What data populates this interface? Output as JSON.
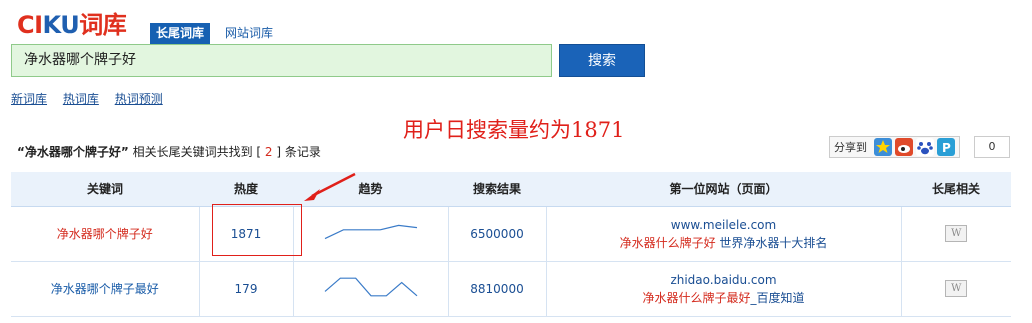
{
  "logo": {
    "part1": "CI",
    "part2": "KU",
    "part3": "词库"
  },
  "tabs": {
    "active": "长尾词库",
    "inactive": "网站词库"
  },
  "search": {
    "value": "净水器哪个牌子好",
    "button": "搜索"
  },
  "links": [
    "新词库",
    "热词库",
    "热词预测"
  ],
  "annotation": "用户日搜索量约为1871",
  "summary": {
    "keyword": "“净水器哪个牌子好”",
    "text1": " 相关长尾关键词共找到 [ ",
    "count": "2",
    "text2": " ] 条记录"
  },
  "share": {
    "label": "分享到",
    "count": "0"
  },
  "table": {
    "headers": [
      "关键词",
      "热度",
      "趋势",
      "搜索结果",
      "第一位网站（页面）",
      "长尾相关"
    ],
    "rows": [
      {
        "keyword": "净水器哪个牌子好",
        "heat": "1871",
        "trend": [
          0.2,
          0.6,
          0.6,
          0.6,
          0.8,
          0.7
        ],
        "results": "6500000",
        "domain": "www.meilele.com",
        "title_red": "净水器什么牌子好",
        "title_blue": " 世界净水器十大排名",
        "related_icon": "W"
      },
      {
        "keyword": "净水器哪个牌子最好",
        "heat": "179",
        "trend": [
          0.3,
          0.9,
          0.9,
          0.1,
          0.1,
          0.7,
          0.1
        ],
        "results": "8810000",
        "domain": "zhidao.baidu.com",
        "title_red": "净水器什么牌子最好",
        "title_blue": "_百度知道",
        "related_icon": "W"
      }
    ]
  },
  "colors": {
    "accent_blue": "#1660b2",
    "link": "#1a4e93",
    "red": "#e0201a"
  }
}
